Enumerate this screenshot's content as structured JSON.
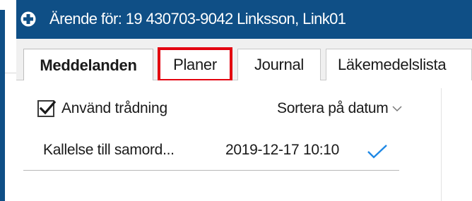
{
  "window": {
    "title": "Ärende för: 19 430703-9042 Linksson, Link01",
    "icon": "plus-circle-icon",
    "colors": {
      "title_bar": "#0f4f86",
      "title_text": "#ffffff",
      "highlight": "#e3000f",
      "accent_check": "#1e88e5"
    }
  },
  "tabs": [
    {
      "label": "Meddelanden",
      "active": true
    },
    {
      "label": "Planer",
      "active": false,
      "highlighted": true
    },
    {
      "label": "Journal",
      "active": false
    },
    {
      "label": "Läkemedelslista",
      "active": false
    }
  ],
  "messages_panel": {
    "threading_checkbox": {
      "label": "Använd trådning",
      "checked": true
    },
    "sort": {
      "label": "Sortera på datum",
      "icon": "chevron-down-icon"
    },
    "messages": [
      {
        "subject": "Kallelse till samord...",
        "date": "2019-12-17 10:10",
        "status_icon": "checkmark-icon"
      }
    ]
  }
}
